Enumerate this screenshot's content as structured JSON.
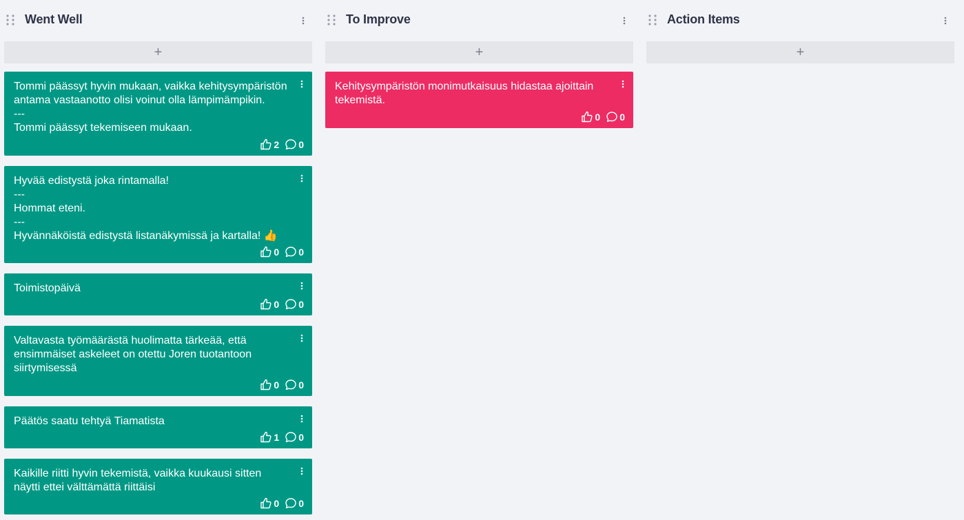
{
  "columns": [
    {
      "title": "Went Well",
      "add_label": "+",
      "cards": [
        {
          "text": "Tommi päässyt hyvin mukaan, vaikka kehitysympäristön\nantama vastaanotto olisi voinut olla lämpimämpikin.\n---\nTommi päässyt tekemiseen mukaan.",
          "likes": "2",
          "comments": "0"
        },
        {
          "text": "Hyvää edistystä joka rintamalla!\n---\nHommat eteni.\n---\nHyvännäköistä edistystä listanäkymissä ja kartalla! 👍",
          "likes": "0",
          "comments": "0"
        },
        {
          "text": "Toimistopäivä",
          "likes": "0",
          "comments": "0"
        },
        {
          "text": "Valtavasta työmäärästä huolimatta tärkeää, että\nensimmäiset askeleet on otettu Joren tuotantoon\nsiirtymisessä",
          "likes": "0",
          "comments": "0"
        },
        {
          "text": "Päätös saatu tehtyä Tiamatista",
          "likes": "1",
          "comments": "0"
        },
        {
          "text": "Kaikille riitti hyvin tekemistä, vaikka kuukausi sitten\nnäytti ettei välttämättä riittäisi",
          "likes": "0",
          "comments": "0"
        }
      ]
    },
    {
      "title": "To Improve",
      "add_label": "+",
      "cards": [
        {
          "text": "Kehitysympäristön monimutkaisuus hidastaa ajoittain\ntekemistä.",
          "likes": "0",
          "comments": "0"
        }
      ]
    },
    {
      "title": "Action Items",
      "add_label": "+",
      "cards": []
    }
  ],
  "colors": {
    "went_well_card": "#009885",
    "to_improve_card": "#ec2c63",
    "background": "#f2f3f7",
    "add_button": "#e5e6ea"
  },
  "icons": {
    "column_drag": "drag-handle-icon",
    "column_menu": "kebab-menu-icon",
    "card_menu": "kebab-menu-icon",
    "like": "thumbs-up-icon",
    "comment": "comment-bubble-icon"
  }
}
